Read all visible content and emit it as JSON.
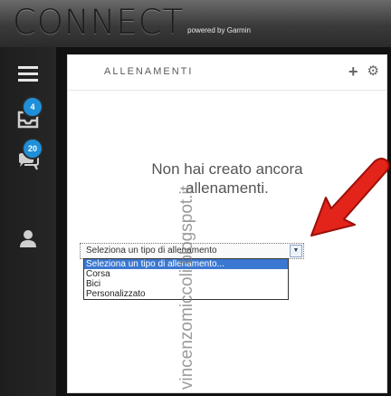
{
  "app": {
    "brand_name": "CONNECT",
    "brand_sub": "powered by Garmin"
  },
  "nav": {
    "badges": [
      "4",
      "20"
    ]
  },
  "panel": {
    "title": "ALLENAMENTI",
    "empty_line1": "Non hai creato ancora",
    "empty_line2": "allenamenti."
  },
  "type_select": {
    "value": "Seleziona un tipo di allenamento",
    "options": [
      "Seleziona un tipo di allenamento...",
      "Corsa",
      "Bici",
      "Personalizzato"
    ],
    "selected_index": 0
  },
  "watermark": {
    "text": "vincenzomiccoli.blogspot.it"
  },
  "colors": {
    "accent_badge": "#1e8fd8",
    "selection": "#3b78d1",
    "arrow": "#e2241b"
  }
}
